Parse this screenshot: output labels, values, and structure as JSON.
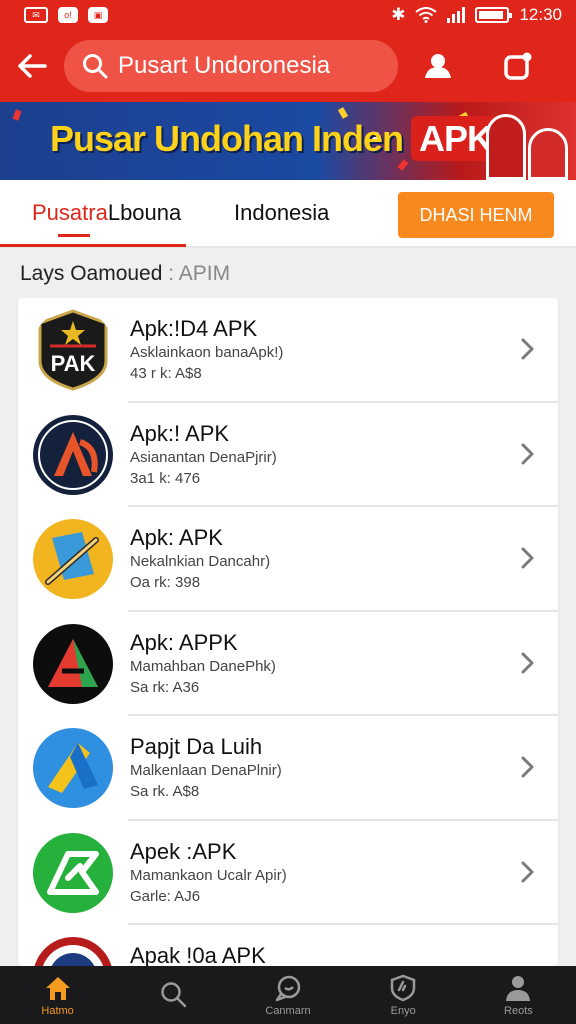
{
  "status_bar": {
    "time": "12:30"
  },
  "header": {
    "search_text": "Pusart Undoronesia"
  },
  "banner": {
    "title": "Pusar Undohan Inden",
    "badge": "APK"
  },
  "tabs": [
    {
      "label_a": "Pusatra",
      "label_b": "Lbouna"
    },
    {
      "label": "Indonesia"
    }
  ],
  "cta": {
    "label": "DHASI HENM"
  },
  "section": {
    "title": "Lays Oamoued",
    "suffix": ": APIM"
  },
  "apps": [
    {
      "name": "Apk:!D4 APK",
      "subtitle": "Asklainkaon banaApk!)",
      "meta": "43 r k: A$8",
      "icon": "pak-star-icon"
    },
    {
      "name": "Apk:! APK",
      "subtitle": "Asianantan DenaPjrir)",
      "meta": "3a1 k: 476",
      "icon": "a-wing-icon"
    },
    {
      "name": "Apk: APK",
      "subtitle": "Nekalnkian Dancahr)",
      "meta": "Oa rk: 398",
      "icon": "flag-hand-icon"
    },
    {
      "name": "Apk: APPK",
      "subtitle": "Mamahban DanePhk)",
      "meta": "Sa rk: A36",
      "icon": "a-triangle-icon"
    },
    {
      "name": "Papjt Da Luih",
      "subtitle": "Malkenlaan DenaPlnir)",
      "meta": "Sa rk. A$8",
      "icon": "blue-wedge-icon"
    },
    {
      "name": "Apek :APK",
      "subtitle": "Mamankaon Ucalr Apir)",
      "meta": "Garle: AJ6",
      "icon": "green-arrow-icon"
    },
    {
      "name": "Apak !0a APK",
      "subtitle": "",
      "meta": "",
      "icon": "red-emblem-icon"
    }
  ],
  "nav": [
    {
      "label": "Hatmo",
      "icon": "home-icon"
    },
    {
      "label": "",
      "icon": "search-icon"
    },
    {
      "label": "Canmarn",
      "icon": "chat-icon"
    },
    {
      "label": "Enyo",
      "icon": "shield-icon"
    },
    {
      "label": "Reots",
      "icon": "person-icon"
    }
  ],
  "colors": {
    "brand": "#e0261b",
    "accent": "#f7891f",
    "nav_bg": "#1a1a1c"
  }
}
